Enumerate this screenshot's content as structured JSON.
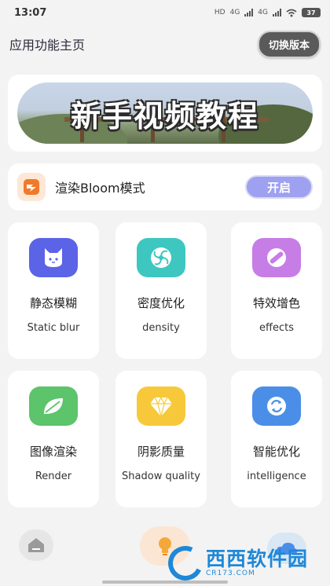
{
  "status_bar": {
    "time": "13:07",
    "network_hd": "HD",
    "network_1": "4G",
    "network_2": "4G",
    "battery": "37"
  },
  "header": {
    "title": "应用功能主页",
    "switch_button": "切换版本"
  },
  "banner": {
    "text": "新手视频教程"
  },
  "bloom": {
    "label": "渲染Bloom模式",
    "button": "开启",
    "icon": "bloom-app-icon"
  },
  "features": [
    {
      "name": "静态模糊",
      "sub": "Static blur",
      "icon": "cat-icon",
      "color": "#5b63e6"
    },
    {
      "name": "密度优化",
      "sub": "density",
      "icon": "swirl-icon",
      "color": "#3ec7c0"
    },
    {
      "name": "特效增色",
      "sub": "effects",
      "icon": "pill-icon",
      "color": "#c77de6"
    },
    {
      "name": "图像渲染",
      "sub": "Render",
      "icon": "leaf-icon",
      "color": "#5cc46a"
    },
    {
      "name": "阴影质量",
      "sub": "Shadow quality",
      "icon": "gem-icon",
      "color": "#f7c93a"
    },
    {
      "name": "智能优化",
      "sub": "intelligence",
      "icon": "refresh-icon",
      "color": "#4a8ee8"
    }
  ],
  "bottom_nav": {
    "items": [
      "home-icon",
      "bulb-icon",
      "cloud-icon"
    ]
  },
  "watermark": {
    "text": "西西软件园",
    "sub": "CR173.COM"
  }
}
